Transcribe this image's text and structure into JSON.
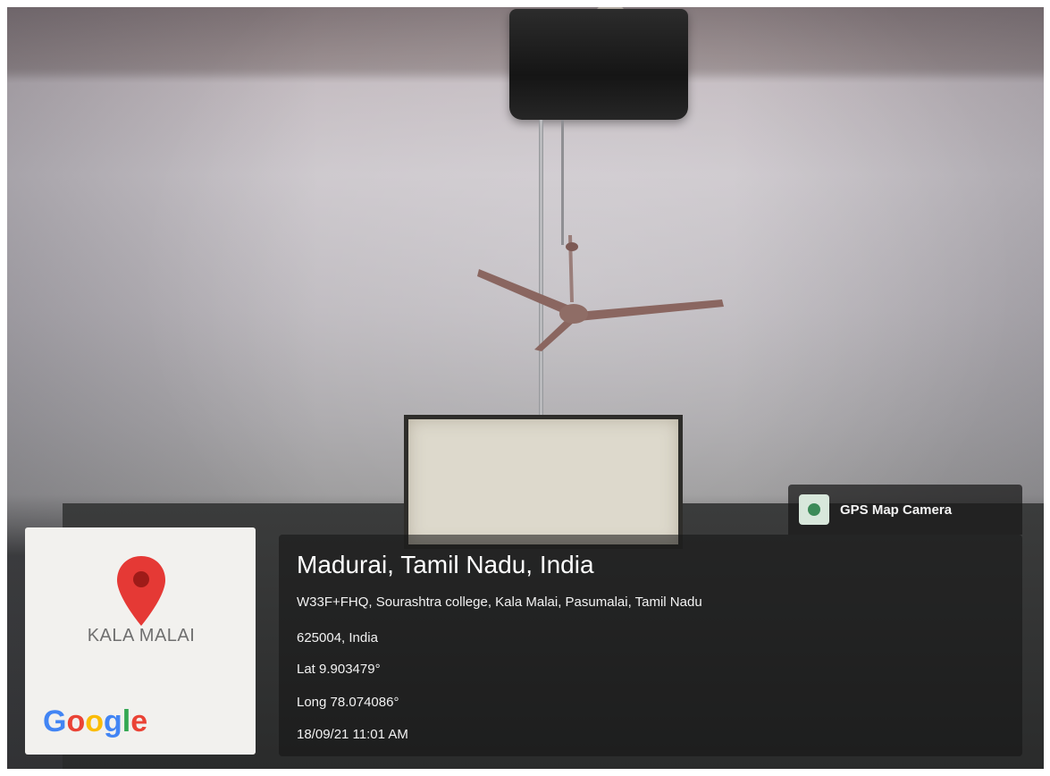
{
  "map_card": {
    "place_label": "KALA MALAI",
    "logo_text": "Google",
    "logo_colors": [
      "#4285F4",
      "#EA4335",
      "#FBBC05",
      "#4285F4",
      "#34A853",
      "#EA4335"
    ],
    "pin_color": "#E53935"
  },
  "badge": {
    "app_name": "GPS Map Camera",
    "icon": "map-camera-icon"
  },
  "location": {
    "city": "Madurai, Tamil Nadu, India",
    "address_line1": "W33F+FHQ, Sourashtra college, Kala Malai, Pasumalai, Tamil Nadu",
    "address_line2": "625004, India",
    "latitude": "Lat 9.903479°",
    "longitude": "Long 78.074086°",
    "datetime": "18/09/21 11:01 AM"
  }
}
